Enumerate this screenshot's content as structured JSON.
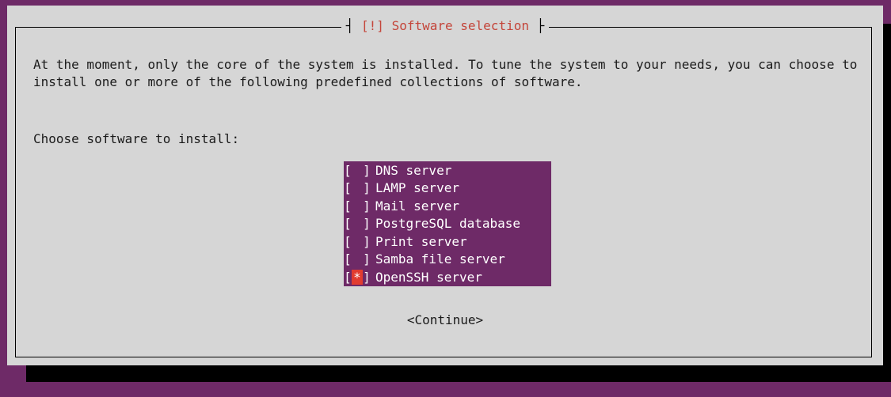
{
  "dialog": {
    "title_prefix": "[!]",
    "title": "Software selection",
    "intro": "At the moment, only the core of the system is installed. To tune the system to your needs, you can choose to install one or more of the following predefined collections of software.",
    "prompt": "Choose software to install:",
    "continue_label": "<Continue>"
  },
  "software": [
    {
      "label": "DNS server",
      "checked": false
    },
    {
      "label": "LAMP server",
      "checked": false
    },
    {
      "label": "Mail server",
      "checked": false
    },
    {
      "label": "PostgreSQL database",
      "checked": false
    },
    {
      "label": "Print server",
      "checked": false
    },
    {
      "label": "Samba file server",
      "checked": false
    },
    {
      "label": "OpenSSH server",
      "checked": true
    }
  ],
  "colors": {
    "background": "#6e2a67",
    "dialog": "#d6d6d6",
    "title": "#c4453a",
    "cursor": "#e23b2f"
  }
}
